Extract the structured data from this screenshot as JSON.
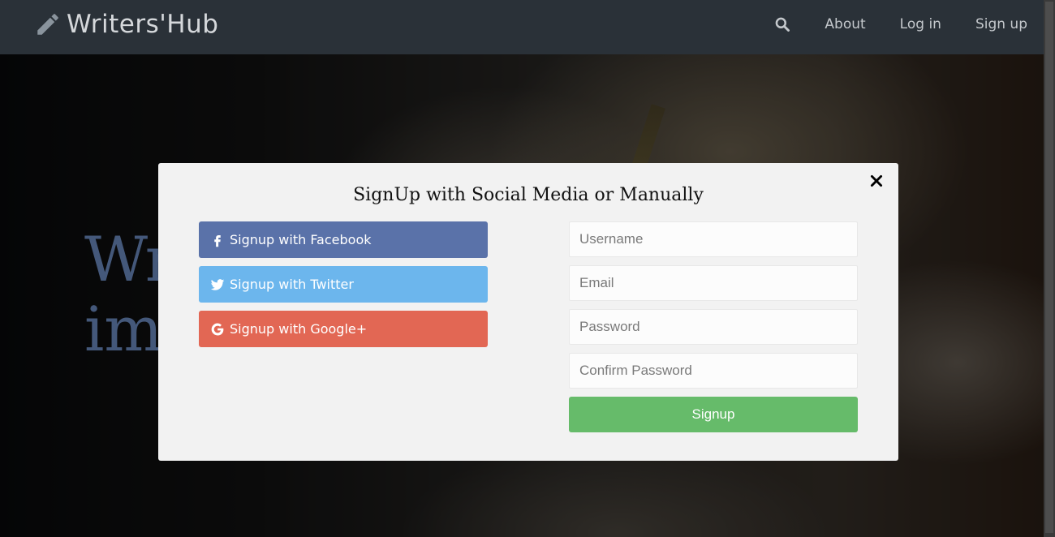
{
  "navbar": {
    "brand": "Writers'Hub",
    "links": [
      "About",
      "Log in",
      "Sign up"
    ]
  },
  "hero": {
    "heading_line1": "Wr",
    "heading_line2": "im"
  },
  "modal": {
    "title": "SignUp with Social Media or Manually",
    "social": {
      "facebook": "Signup with Facebook",
      "twitter": "Signup with Twitter",
      "google": "Signup with Google+"
    },
    "form": {
      "username_placeholder": "Username",
      "email_placeholder": "Email",
      "password_placeholder": "Password",
      "confirm_placeholder": "Confirm Password",
      "submit_label": "Signup"
    }
  },
  "colors": {
    "navbar_bg": "#2a3138",
    "modal_bg": "#f2f2f2",
    "facebook": "#5a72a9",
    "twitter": "#6cb6ed",
    "google": "#e26754",
    "signup": "#66bb6a"
  },
  "icons": [
    "pencil-icon",
    "search-icon",
    "close-icon",
    "facebook-icon",
    "twitter-icon",
    "google-icon"
  ]
}
